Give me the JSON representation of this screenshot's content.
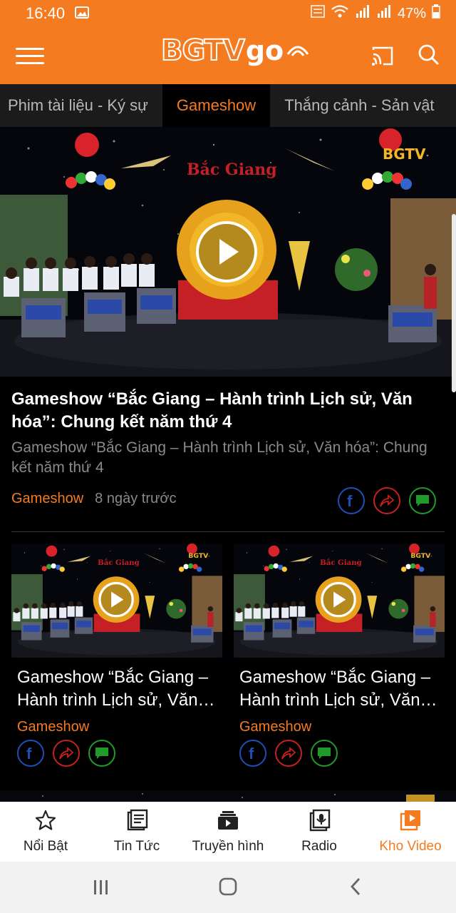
{
  "status_bar": {
    "time": "16:40",
    "battery": "47%"
  },
  "header": {
    "logo_main": "BGTV",
    "logo_suffix": "go"
  },
  "tabs": [
    {
      "label": "Phim tài liệu - Ký sự"
    },
    {
      "label": "Gameshow"
    },
    {
      "label": "Thắng cảnh - Sản vật"
    }
  ],
  "featured": {
    "stage_sign": "Bắc Giang",
    "stage_corner_logo": "BGTV",
    "title": "Gameshow “Bắc Giang – Hành trình Lịch sử, Văn hóa”: Chung kết năm thứ 4",
    "subtitle": "Gameshow “Bắc Giang – Hành trình Lịch sử, Văn hóa”: Chung kết năm thứ 4",
    "category": "Gameshow",
    "time_ago": "8 ngày trước"
  },
  "cards": [
    {
      "title": "Gameshow “Bắc Giang – Hành trình Lịch sử, Văn hóa”",
      "category": "Gameshow"
    },
    {
      "title": "Gameshow “Bắc Giang – Hành trình Lịch sử, Văn hóa”",
      "category": "Gameshow"
    }
  ],
  "bottom_nav": [
    {
      "label": "Nổi Bật",
      "icon": "star-icon"
    },
    {
      "label": "Tin Tức",
      "icon": "news-icon"
    },
    {
      "label": "Truyền hình",
      "icon": "tv-icon"
    },
    {
      "label": "Radio",
      "icon": "radio-icon"
    },
    {
      "label": "Kho Video",
      "icon": "video-library-icon"
    }
  ],
  "active_tab": "Gameshow",
  "active_nav": "Kho Video",
  "colors": {
    "brand_orange": "#f47b20",
    "facebook_blue": "#1e4fb8",
    "share_red": "#c62020",
    "comment_green": "#1f9a2b"
  }
}
